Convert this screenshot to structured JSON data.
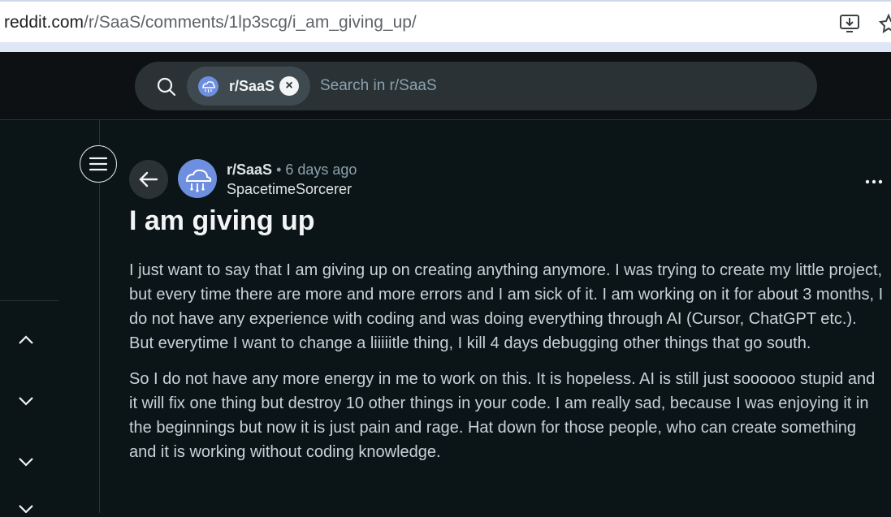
{
  "browser": {
    "url_domain": "reddit.com",
    "url_path": "/r/SaaS/comments/1lp3scg/i_am_giving_up/"
  },
  "search": {
    "chip_label": "r/SaaS",
    "placeholder": "Search in r/SaaS"
  },
  "post": {
    "subreddit": "r/SaaS",
    "time": "• 6 days ago",
    "author": "SpacetimeSorcerer",
    "title": "I am giving up",
    "paragraphs": [
      "I just want to say that I am giving up on creating anything anymore. I was trying to create my little project, but every time there are more and more errors and I am sick of it. I am working on it for about 3 months, I do not have any experience with coding and was doing everything through AI (Cursor, ChatGPT etc.). But everytime I want to change a liiiiitle thing, I kill 4 days debugging other things that go south.",
      "So I do not have any more energy in me to work on this. It is hopeless. AI is still just soooooo stupid and it will fix one thing but destroy 10 other things in your code. I am really sad, because I was enjoying it in the beginnings but now it is just pain and rage. Hat down for those people, who can create something and it is working without coding knowledge."
    ]
  },
  "icons": {
    "download": "download-icon",
    "bookmark": "star-icon",
    "search": "search-icon",
    "close": "close-icon",
    "menu": "hamburger-menu-icon",
    "back": "arrow-left-icon",
    "more": "more-horizontal-icon",
    "rail_chevrons": [
      "chevron-up-icon",
      "chevron-down-icon",
      "chevron-down-icon",
      "chevron-down-icon"
    ]
  },
  "colors": {
    "background": "#0b1416",
    "header": "#0e1113",
    "search_bg": "#2a3236",
    "avatar": "#6e8fe0",
    "text": "#f2f4f5",
    "muted": "#8ba2ad"
  }
}
